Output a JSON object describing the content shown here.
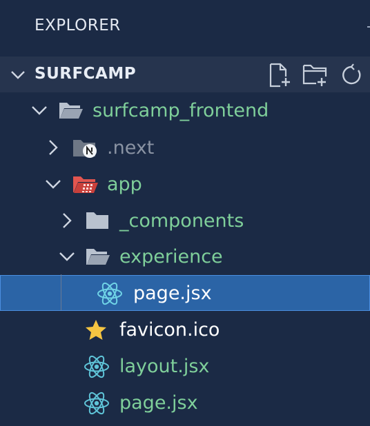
{
  "explorer": {
    "title": "EXPLORER"
  },
  "section": {
    "title": "SURFCAMP"
  },
  "actions": [
    {
      "name": "new-file-icon"
    },
    {
      "name": "new-folder-icon"
    },
    {
      "name": "refresh-icon"
    }
  ],
  "tree": [
    {
      "label": "surfcamp_frontend",
      "kind": "folder-open",
      "expanded": true,
      "color": "#7fcf9a"
    },
    {
      "label": ".next",
      "kind": "folder-next",
      "expanded": false,
      "color": "#8a93a3"
    },
    {
      "label": "app",
      "kind": "folder-app",
      "expanded": true,
      "color": "#7fcf9a"
    },
    {
      "label": "_components",
      "kind": "folder",
      "expanded": false,
      "color": "#7fcf9a"
    },
    {
      "label": "experience",
      "kind": "folder-open",
      "expanded": true,
      "color": "#7fcf9a"
    },
    {
      "label": "page.jsx",
      "kind": "react",
      "selected": true,
      "color": "#ffffff"
    },
    {
      "label": "favicon.ico",
      "kind": "star",
      "color": "#ffffff"
    },
    {
      "label": "layout.jsx",
      "kind": "react",
      "color": "#7fcf9a"
    },
    {
      "label": "page.jsx",
      "kind": "react",
      "color": "#7fcf9a"
    }
  ],
  "colors": {
    "background": "#1b2a45",
    "section_bar": "#26344e",
    "selection": "#2b64a6",
    "react": "#5fc4d8",
    "star": "#f5c542",
    "app_folder": "#e2554f"
  }
}
